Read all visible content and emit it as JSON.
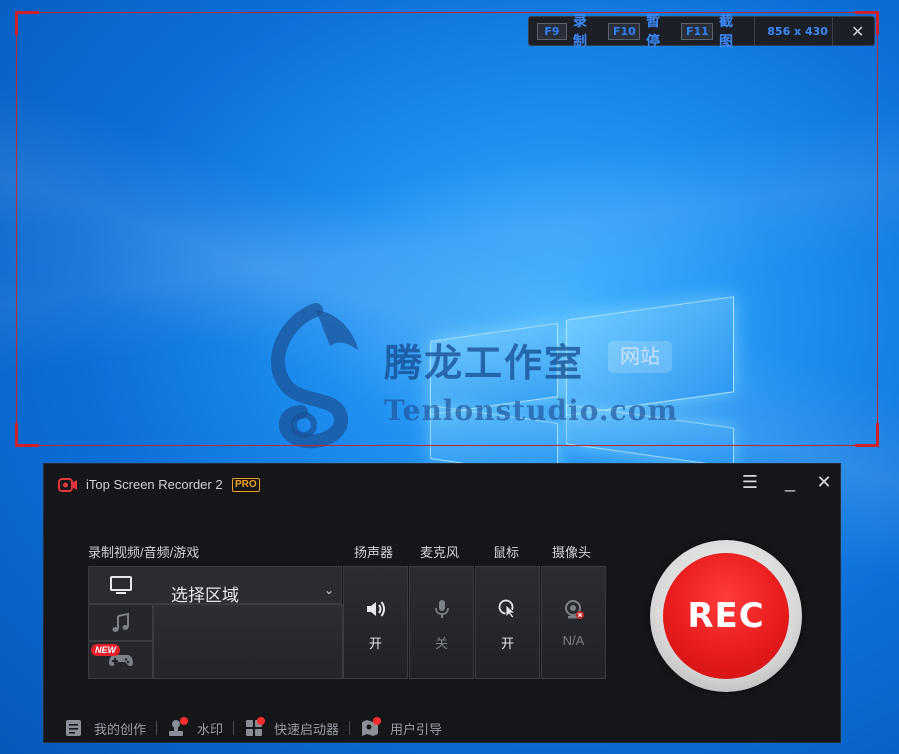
{
  "capture_toolbar": {
    "record_key": "F9",
    "record_label": "录制",
    "pause_key": "F10",
    "pause_label": "暂停",
    "screenshot_key": "F11",
    "screenshot_label": "截图",
    "dimensions": "856 x 430",
    "close_glyph": "✕"
  },
  "watermark": {
    "chinese_text": "腾龙工作室",
    "badge_text": "网站",
    "english_text": "Tenlonstudio.com"
  },
  "app": {
    "title": "iTop Screen Recorder 2",
    "pro_badge": "PRO",
    "menu_glyph": "☰",
    "minimize_glyph": "_",
    "close_glyph": "✕",
    "section_labels": {
      "record_mode": "录制视频/音频/游戏",
      "speaker": "扬声器",
      "microphone": "麦克风",
      "mouse": "鼠标",
      "camera": "摄像头"
    },
    "new_badge": "NEW",
    "area_select": {
      "label": "选择区域",
      "chevron": "⌄"
    },
    "toggles": {
      "speaker_state": "开",
      "microphone_state": "关",
      "mouse_state": "开",
      "camera_state": "N/A"
    },
    "rec_label": "REC",
    "footer": {
      "my_creations": "我的创作",
      "watermark": "水印",
      "quick_launcher": "快速启动器",
      "user_guide": "用户引导"
    }
  },
  "colors": {
    "accent_blue": "#3b8bff",
    "capture_border": "#d0202a",
    "rec_red": "#e81c1c",
    "pro_orange": "#f0a01e",
    "app_bg": "#15161a"
  }
}
